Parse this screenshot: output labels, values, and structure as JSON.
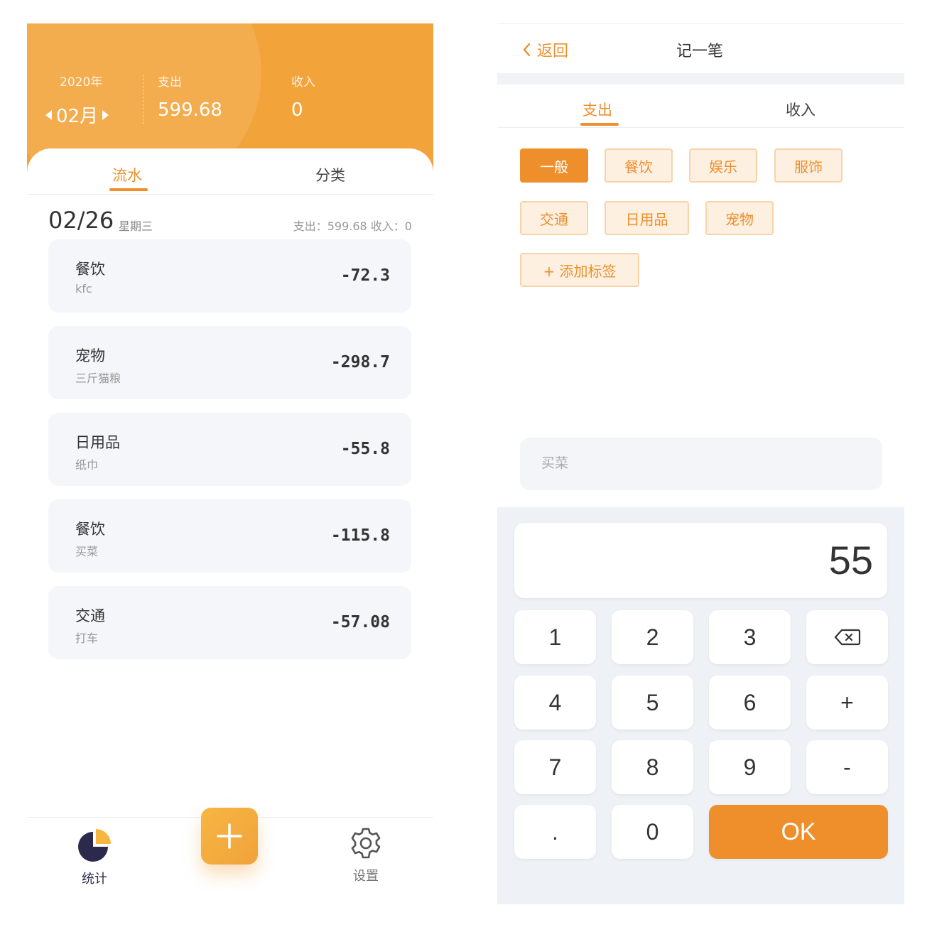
{
  "left": {
    "header": {
      "year": "2020年",
      "month": "02月",
      "expense_label": "支出",
      "expense_value": "599.68",
      "income_label": "收入",
      "income_value": "0"
    },
    "tabs": [
      "流水",
      "分类"
    ],
    "date_group": {
      "date": "02/26",
      "weekday": "星期三",
      "summary": "支出：599.68 收入：0"
    },
    "records": [
      {
        "category": "餐饮",
        "note": "kfc",
        "amount": "-72.3"
      },
      {
        "category": "宠物",
        "note": "三斤猫粮",
        "amount": "-298.7"
      },
      {
        "category": "日用品",
        "note": "纸巾",
        "amount": "-55.8"
      },
      {
        "category": "餐饮",
        "note": "买菜",
        "amount": "-115.8"
      },
      {
        "category": "交通",
        "note": "打车",
        "amount": "-57.08"
      }
    ],
    "bottom_nav": {
      "stats_label": "统计",
      "settings_label": "设置",
      "add_icon": "plus-icon"
    }
  },
  "right": {
    "back_label": "返回",
    "title": "记一笔",
    "tabs": [
      "支出",
      "收入"
    ],
    "tags": [
      "一般",
      "餐饮",
      "娱乐",
      "服饰",
      "交通",
      "日用品",
      "宠物"
    ],
    "selected_tag": "一般",
    "add_tag_label": "+ 添加标签",
    "note_placeholder": "买菜",
    "amount_display": "55",
    "keys": [
      "1",
      "2",
      "3",
      "backspace",
      "4",
      "5",
      "6",
      "+",
      "7",
      "8",
      "9",
      "-",
      ".",
      "0",
      "OK"
    ]
  },
  "colors": {
    "accent": "#ee8f2b",
    "header_bg": "#f2a33a",
    "tag_bg": "#fdf0e1",
    "tag_border": "#f8d3a8",
    "stats_icon_dark": "#2b2a4c",
    "stats_icon_light": "#f7b642"
  }
}
